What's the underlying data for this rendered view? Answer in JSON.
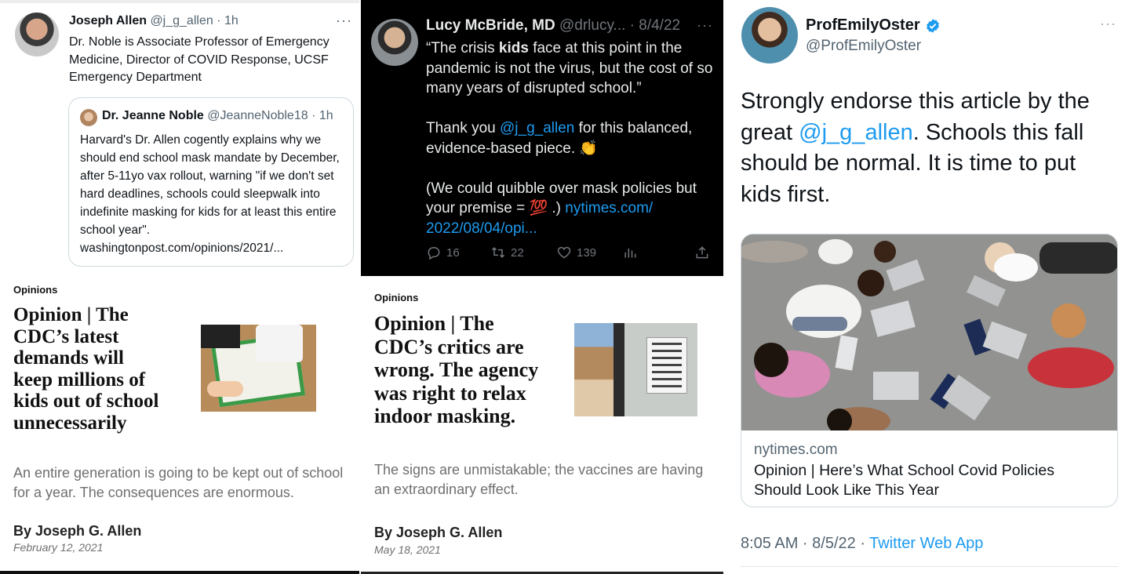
{
  "panel1": {
    "tweet": {
      "author_name": "Joseph Allen",
      "handle_time": "@j_g_allen · 1h",
      "more": "···",
      "text": "Dr. Noble is Associate Professor of Emergency Medicine, Director of COVID Response, UCSF Emergency Department"
    },
    "quote": {
      "author_name": "Dr. Jeanne Noble",
      "handle_time": "@JeanneNoble18 · 1h",
      "text": "Harvard's Dr. Allen cogently explains why we should end school mask mandate by December, after 5-11yo vax rollout, warning \"if we don't set hard deadlines, schools could sleepwalk into indefinite masking for kids for at least this entire school year\". washingtonpost.com/opinions/2021/..."
    },
    "article": {
      "kicker": "Opinions",
      "title": "Opinion | The CDC’s latest demands will keep millions of kids out of school unnecessarily",
      "dek": "An entire generation is going to be kept out of school for a year. The consequences are enormous.",
      "byline": "By Joseph G. Allen",
      "date": "February 12, 2021"
    }
  },
  "panel2": {
    "tweet": {
      "author_name": "Lucy McBride, MD",
      "handle_time": "@drlucy... · 8/4/22",
      "more": "···",
      "para1_a": "“The crisis ",
      "para1_bold": "kids",
      "para1_b": " face at this point in the pandemic is not the virus, but the cost of so many years of disrupted school.”",
      "para2_a": "Thank you ",
      "para2_link": "@j_g_allen",
      "para2_b": " for this balanced, evidence-based piece. 👏",
      "para3_a": "(We could quibble over mask policies but your premise = 💯 .) ",
      "para3_link": "nytimes.com/ 2022/08/04/opi...",
      "replies": "16",
      "retweets": "22",
      "likes": "139"
    },
    "article": {
      "kicker": "Opinions",
      "title": "Opinion | The CDC’s critics are wrong. The agency was right to relax indoor masking.",
      "dek": "The signs are unmistakable; the vaccines are having an extraordinary effect.",
      "byline": "By Joseph G. Allen",
      "date": "May 18, 2021"
    }
  },
  "panel3": {
    "tweet": {
      "author_name": "ProfEmilyOster",
      "handle": "@ProfEmilyOster",
      "more": "···",
      "text_a": "Strongly endorse this article by the great ",
      "text_link": "@j_g_allen",
      "text_b": ".  Schools this fall should be normal. It is time to put kids first.",
      "card_domain": "nytimes.com",
      "card_title": "Opinion | Here’s What School Covid Policies Should Look Like This Year",
      "timestamp": "8:05 AM · 8/5/22 · ",
      "source": "Twitter Web App"
    }
  },
  "colors": {
    "twitter_blue": "#1d9bf0",
    "dark_bg": "#000000",
    "muted_text": "#536471"
  }
}
